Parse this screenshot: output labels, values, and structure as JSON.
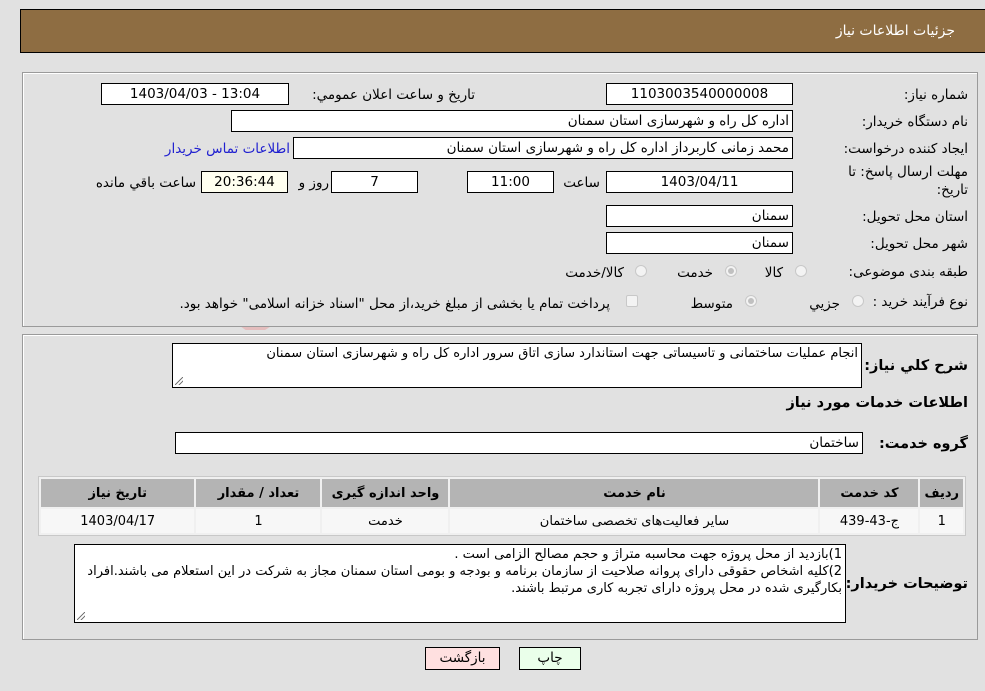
{
  "header": {
    "title": "جزئیات اطلاعات نیاز"
  },
  "details": {
    "need_number_label": "شماره نیاز:",
    "need_number": "1103003540000008",
    "announce_label": "تاریخ و ساعت اعلان عمومي:",
    "announce_value": "1403/04/03 - 13:04",
    "buyer_org_label": "نام دستگاه خریدار:",
    "buyer_org": "اداره کل راه و شهرسازی استان سمنان",
    "creator_label": "ایجاد کننده درخواست:",
    "creator": "محمد زمانی کاربرداز اداره کل راه و شهرسازی استان سمنان",
    "contact_link": "اطلاعات تماس خریدار",
    "deadline_label_line1": "مهلت ارسال پاسخ: تا",
    "deadline_label_line2": "تاریخ:",
    "deadline_date": "1403/04/11",
    "time_label": "ساعت",
    "deadline_time": "11:00",
    "days_value": "7",
    "days_label": "روز و",
    "remaining_time": "20:36:44",
    "remaining_label": "ساعت باقي مانده",
    "province_label": "استان محل تحویل:",
    "province": "سمنان",
    "city_label": "شهر محل تحویل:",
    "city": "سمنان",
    "category_label": "طبقه بندی موضوعی:",
    "category_options": [
      {
        "label": "کالا",
        "selected": false
      },
      {
        "label": "خدمت",
        "selected": true
      },
      {
        "label": "کالا/خدمت",
        "selected": false
      }
    ],
    "process_label": "نوع فرآیند خرید :",
    "process_options": [
      {
        "label": "جزيي",
        "selected": false
      },
      {
        "label": "متوسط",
        "selected": true
      }
    ],
    "treasury_note": "پرداخت تمام یا بخشی از مبلغ خرید،از محل \"اسناد خزانه اسلامی\" خواهد بود."
  },
  "description": {
    "label": "شرح کلي نیاز:",
    "value": "انجام عملیات ساختمانی و تاسیساتی جهت استاندارد سازی اتاق سرور اداره کل راه و شهرسازی استان سمنان"
  },
  "services": {
    "section_title": "اطلاعات خدمات مورد نیاز",
    "group_label": "گروه خدمت:",
    "group_value": "ساختمان",
    "columns": [
      "ردیف",
      "کد خدمت",
      "نام خدمت",
      "واحد اندازه گیری",
      "تعداد / مقدار",
      "تاریخ نیاز"
    ],
    "rows": [
      [
        "1",
        "ج-43-439",
        "سایر فعالیت‌های تخصصی ساختمان",
        "خدمت",
        "1",
        "1403/04/17"
      ]
    ]
  },
  "buyer_notes": {
    "label": "توضیحات خریدار:",
    "lines": [
      "1)بازدید از محل پروژه جهت محاسبه متراژ و حجم مصالح الزامی است .",
      "2)کلیه اشخاص حقوقی دارای پروانه صلاحیت از سازمان برنامه و بودجه و بومی استان سمنان مجاز به شرکت در این استعلام می باشند.افراد بکارگیری شده در محل پروژه دارای تجربه کاری مرتبط باشند."
    ]
  },
  "buttons": {
    "print": "چاپ",
    "back": "بازگشت"
  },
  "colors": {
    "header": "#8e6d42",
    "print_bg": "#eaffea",
    "back_bg": "#ffe0e0",
    "link": "#2020d0"
  }
}
